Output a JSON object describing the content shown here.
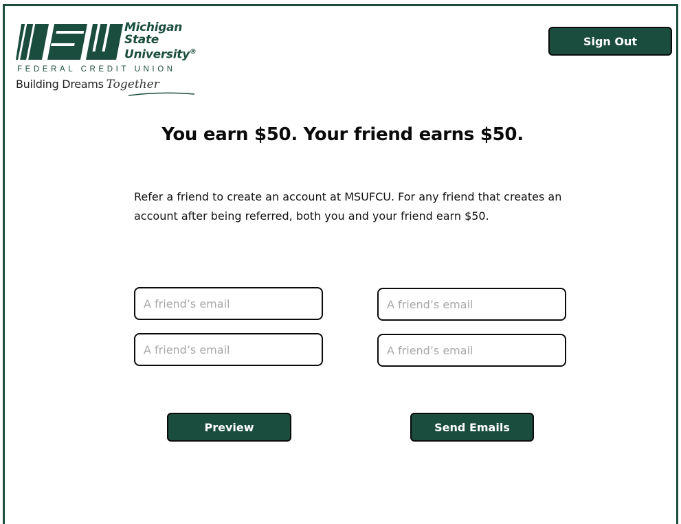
{
  "logo": {
    "name_lines": [
      "Michigan",
      "State",
      "University"
    ],
    "registered_mark": "®",
    "subtitle": "FEDERAL CREDIT UNION",
    "tagline_main": "Building Dreams",
    "tagline_script": "Together"
  },
  "header": {
    "sign_out_label": "Sign Out"
  },
  "main": {
    "headline": "You earn $50. Your friend earns $50.",
    "description": "Refer a friend to create an account at MSUFCU. For any friend that creates an account after being referred, both you and your friend earn $50.",
    "email_fields": [
      {
        "value": "",
        "placeholder": "A friend’s email"
      },
      {
        "value": "",
        "placeholder": "A friend’s email"
      },
      {
        "value": "",
        "placeholder": "A friend’s email"
      },
      {
        "value": "",
        "placeholder": "A friend’s email"
      }
    ],
    "preview_label": "Preview",
    "send_label": "Send Emails"
  },
  "colors": {
    "brand_green": "#1b4d3e",
    "border": "#0a0a0a",
    "placeholder": "#a8a8a8"
  }
}
